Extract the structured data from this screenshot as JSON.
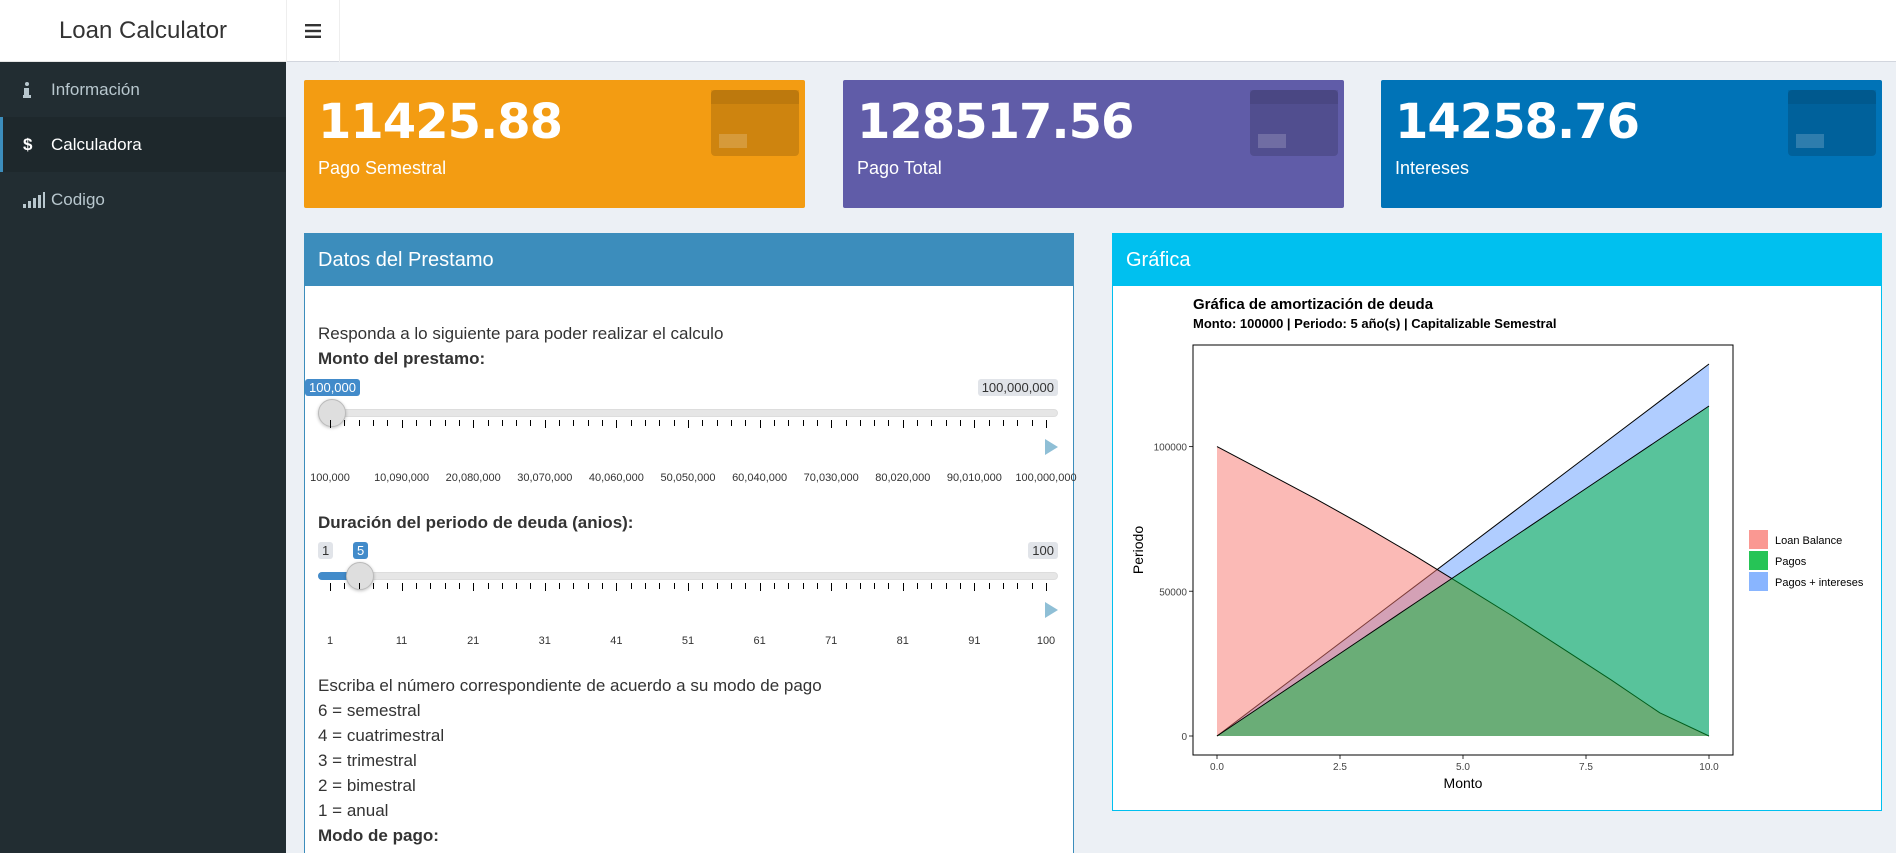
{
  "app": {
    "title": "Loan Calculator",
    "menu_icon": "hamburger-icon"
  },
  "sidebar": {
    "items": [
      {
        "label": "Información",
        "icon": "info-icon"
      },
      {
        "label": "Calculadora",
        "icon": "dollar-icon",
        "active": true
      },
      {
        "label": "Codigo",
        "icon": "signal-bars-icon"
      }
    ]
  },
  "value_boxes": [
    {
      "value": "11425.88",
      "label": "Pago Semestral",
      "color": "#f39c12",
      "icon": "credit-card-icon"
    },
    {
      "value": "128517.56",
      "label": "Pago Total",
      "color": "#605ca8",
      "icon": "credit-card-icon"
    },
    {
      "value": "14258.76",
      "label": "Intereses",
      "color": "#0073b7",
      "icon": "credit-card-icon"
    }
  ],
  "form": {
    "title": "Datos del Prestamo",
    "intro": "Responda a lo siguiente para poder realizar el calculo",
    "monto_label": "Monto del prestamo:",
    "monto_slider": {
      "min_label": "100,000",
      "max_label": "100,000,000",
      "value_label": "100,000",
      "value": 100000,
      "min": 100000,
      "max": 100000000,
      "ticks": [
        "100,000",
        "10,090,000",
        "20,080,000",
        "30,070,000",
        "40,060,000",
        "50,050,000",
        "60,040,000",
        "70,030,000",
        "80,020,000",
        "90,010,000",
        "100,000,000"
      ]
    },
    "duracion_label": "Duración del periodo de deuda (anios):",
    "duracion_slider": {
      "min_label": "1",
      "max_label": "100",
      "value_label": "5",
      "value": 5,
      "min": 1,
      "max": 100,
      "ticks": [
        "1",
        "11",
        "21",
        "31",
        "41",
        "51",
        "61",
        "71",
        "81",
        "91",
        "100"
      ]
    },
    "modo_intro": "Escriba el número correspondiente de acuerdo a su modo de pago",
    "modo_options": [
      "6 = semestral",
      "4 = cuatrimestral",
      "3 = trimestral",
      "2 = bimestral",
      "1 = anual"
    ],
    "modo_label": "Modo de pago:"
  },
  "chart_box": {
    "title": "Gráfica"
  },
  "chart_data": {
    "type": "area",
    "title": "Gráfica de amortización de deuda",
    "subtitle": "Monto:  100000 | Periodo:  5  año(s) | Capitalizable  Semestral",
    "xlabel": "Monto",
    "ylabel": "Periodo",
    "xlim": [
      0,
      10
    ],
    "ylim": [
      0,
      128517.56
    ],
    "x_ticks": [
      "0.0",
      "2.5",
      "5.0",
      "7.5",
      "10.0"
    ],
    "y_ticks": [
      "0",
      "50000",
      "100000"
    ],
    "grid": false,
    "legend_position": "right",
    "x": [
      0,
      1,
      2,
      3,
      4,
      5,
      6,
      7,
      8,
      9,
      10
    ],
    "series": [
      {
        "name": "Loan Balance",
        "color": "#f8766d",
        "values": [
          100000,
          91000,
          82000,
          72500,
          62500,
          52000,
          41500,
          30500,
          19500,
          8000,
          0
        ]
      },
      {
        "name": "Pagos",
        "color": "#00ba38",
        "values": [
          0,
          11400,
          22800,
          34200,
          45600,
          57000,
          68400,
          79800,
          91200,
          102600,
          114000
        ]
      },
      {
        "name": "Pagos + intereses",
        "color": "#619cff",
        "values": [
          0,
          12852,
          25704,
          38555,
          51407,
          64259,
          77111,
          89962,
          102814,
          115666,
          128518
        ]
      }
    ]
  }
}
